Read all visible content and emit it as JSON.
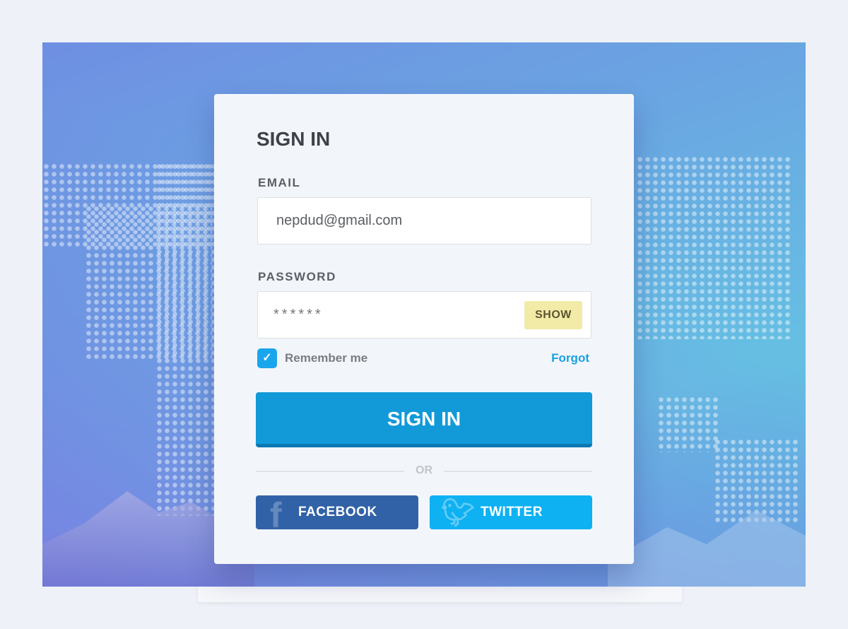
{
  "form": {
    "title": "SIGN IN",
    "email_label": "EMAIL",
    "email_value": "nepdud@gmail.com",
    "password_label": "PASSWORD",
    "password_value": "******",
    "show_label": "SHOW",
    "remember_label": "Remember me",
    "remember_checked": true,
    "forgot_label": "Forgot",
    "signin_label": "SIGN IN",
    "or_label": "OR",
    "facebook_label": "FACEBOOK",
    "twitter_label": "TWITTER"
  },
  "colors": {
    "primary": "#129ad8",
    "facebook": "#3162a7",
    "twitter": "#0eb1f2",
    "show_bg": "#f2eba8"
  }
}
